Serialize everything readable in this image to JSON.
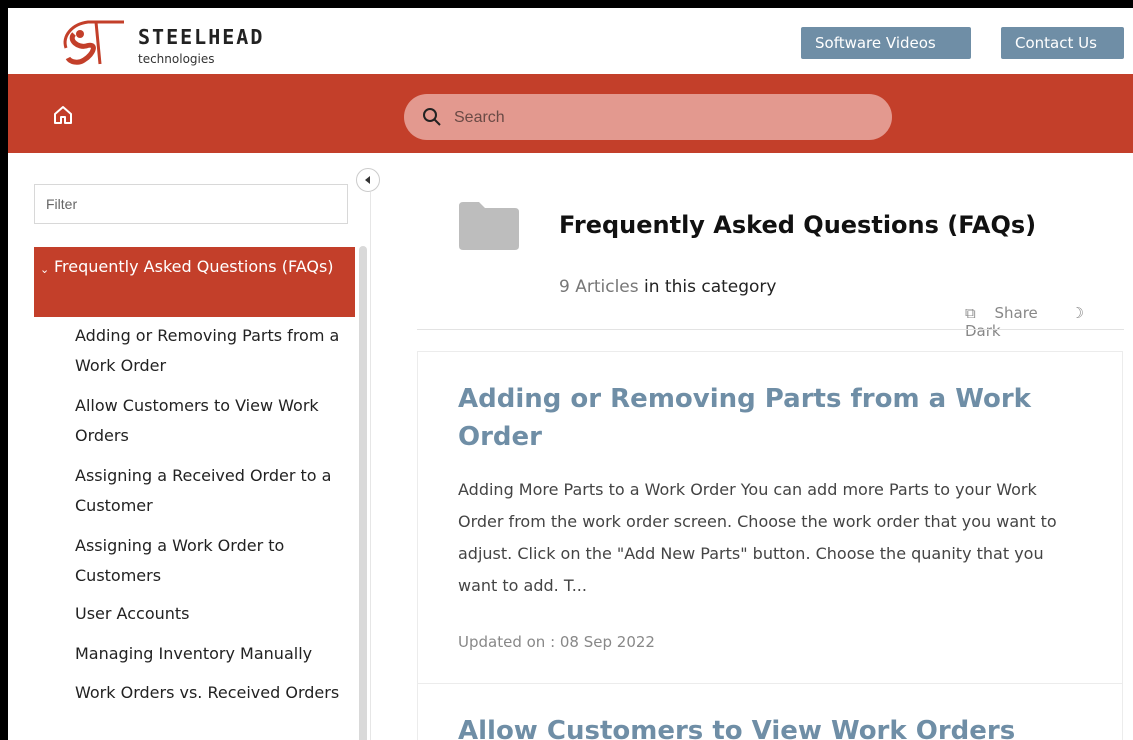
{
  "brand": {
    "name": "STEELHEAD",
    "tagline": "technologies"
  },
  "header": {
    "software_videos_label": "Software Videos",
    "contact_us_label": "Contact Us"
  },
  "search": {
    "placeholder": "Search"
  },
  "sidebar": {
    "filter_placeholder": "Filter",
    "active_category": "Frequently Asked Questions (FAQs)",
    "items": [
      {
        "label": "Adding or Removing Parts from a Work Order"
      },
      {
        "label": "Allow Customers to View Work Orders"
      },
      {
        "label": "Assigning a Received Order to a Customer"
      },
      {
        "label": "Assigning a Work Order to Customers"
      },
      {
        "label": "User Accounts"
      },
      {
        "label": "Managing Inventory Manually"
      },
      {
        "label": "Work Orders vs. Received Orders"
      }
    ]
  },
  "category": {
    "title": "Frequently Asked Questions (FAQs)",
    "article_count": "9 Articles",
    "count_suffix": "in this category",
    "share_label": "Share",
    "dark_label": "Dark"
  },
  "articles": [
    {
      "title": "Adding or Removing Parts from a Work Order",
      "excerpt": "Adding More Parts to a Work Order You can add more Parts to your Work Order from the work order screen. Choose the work order that you want to adjust. Click on the \"Add New Parts\" button. Choose the quanity that you want to add. T...",
      "updated": "Updated on : 08 Sep 2022"
    },
    {
      "title": "Allow Customers to View Work Orders"
    }
  ],
  "colors": {
    "brand_red": "#c33f2a",
    "button_blue": "#6f8ea6",
    "article_title": "#6f8ea6"
  },
  "icons": [
    "home-icon",
    "search-icon",
    "folder-icon",
    "share-icon",
    "moon-icon",
    "chevron-down-icon",
    "collapse-left-icon"
  ]
}
